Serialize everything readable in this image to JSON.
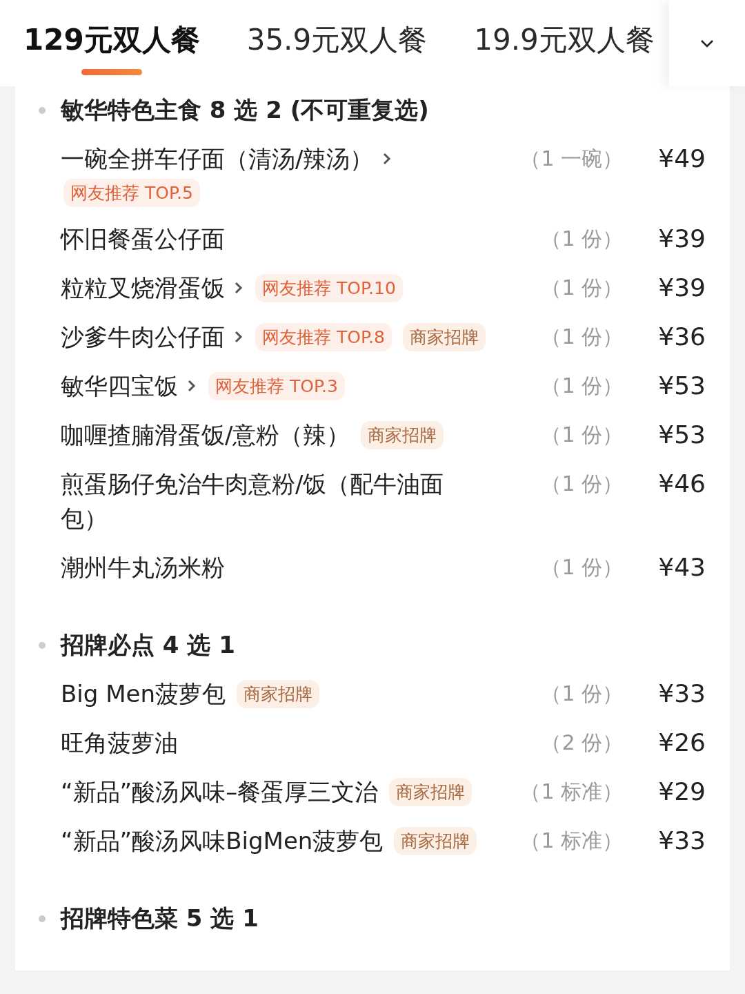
{
  "tabs": [
    {
      "label": "129元双人餐",
      "selected": true
    },
    {
      "label": "35.9元双人餐",
      "selected": false
    },
    {
      "label": "19.9元双人餐",
      "selected": false
    }
  ],
  "sections": [
    {
      "title": "敏华特色主食 8 选 2 (不可重复选)",
      "items": [
        {
          "name": "一碗全拼车仔面（清汤/辣汤）",
          "has_detail": true,
          "tags": [
            {
              "label": "网友推荐 TOP.5",
              "kind": "recommend"
            }
          ],
          "quantity": "（1 一碗）",
          "price": "¥49"
        },
        {
          "name": "怀旧餐蛋公仔面",
          "has_detail": false,
          "quantity": "（1 份）",
          "price": "¥39"
        },
        {
          "name": "粒粒叉烧滑蛋饭",
          "has_detail": true,
          "tags": [
            {
              "label": "网友推荐 TOP.10",
              "kind": "recommend"
            }
          ],
          "quantity": "（1 份）",
          "price": "¥39"
        },
        {
          "name": "沙爹牛肉公仔面",
          "has_detail": true,
          "tags": [
            {
              "label": "网友推荐 TOP.8",
              "kind": "recommend"
            },
            {
              "label": "商家招牌",
              "kind": "signature"
            }
          ],
          "quantity": "（1 份）",
          "price": "¥36"
        },
        {
          "name": "敏华四宝饭",
          "has_detail": true,
          "tags": [
            {
              "label": "网友推荐 TOP.3",
              "kind": "recommend"
            }
          ],
          "quantity": "（1 份）",
          "price": "¥53"
        },
        {
          "name": "咖喱揸腩滑蛋饭/意粉（辣）",
          "has_detail": false,
          "tags": [
            {
              "label": "商家招牌",
              "kind": "signature"
            }
          ],
          "quantity": "（1 份）",
          "price": "¥53"
        },
        {
          "name": "煎蛋肠仔免治牛肉意粉/饭（配牛油面包）",
          "has_detail": false,
          "quantity": "（1 份）",
          "price": "¥46"
        },
        {
          "name": "潮州牛丸汤米粉",
          "has_detail": false,
          "quantity": "（1 份）",
          "price": "¥43"
        }
      ]
    },
    {
      "title": "招牌必点 4 选 1",
      "items": [
        {
          "name": "Big Men菠萝包",
          "has_detail": false,
          "tags": [
            {
              "label": "商家招牌",
              "kind": "signature"
            }
          ],
          "quantity": "（1 份）",
          "price": "¥33"
        },
        {
          "name": "旺角菠萝油",
          "has_detail": false,
          "quantity": "（2 份）",
          "price": "¥26"
        },
        {
          "name": "“新品”酸汤风味–餐蛋厚三文治",
          "has_detail": false,
          "tags": [
            {
              "label": "商家招牌",
              "kind": "signature"
            }
          ],
          "quantity": "（1 标准）",
          "price": "¥29"
        },
        {
          "name": "“新品”酸汤风味BigMen菠萝包",
          "has_detail": false,
          "tags": [
            {
              "label": "商家招牌",
              "kind": "signature"
            }
          ],
          "quantity": "（1 标准）",
          "price": "¥33"
        }
      ]
    },
    {
      "title": "招牌特色菜 5 选 1"
    }
  ]
}
